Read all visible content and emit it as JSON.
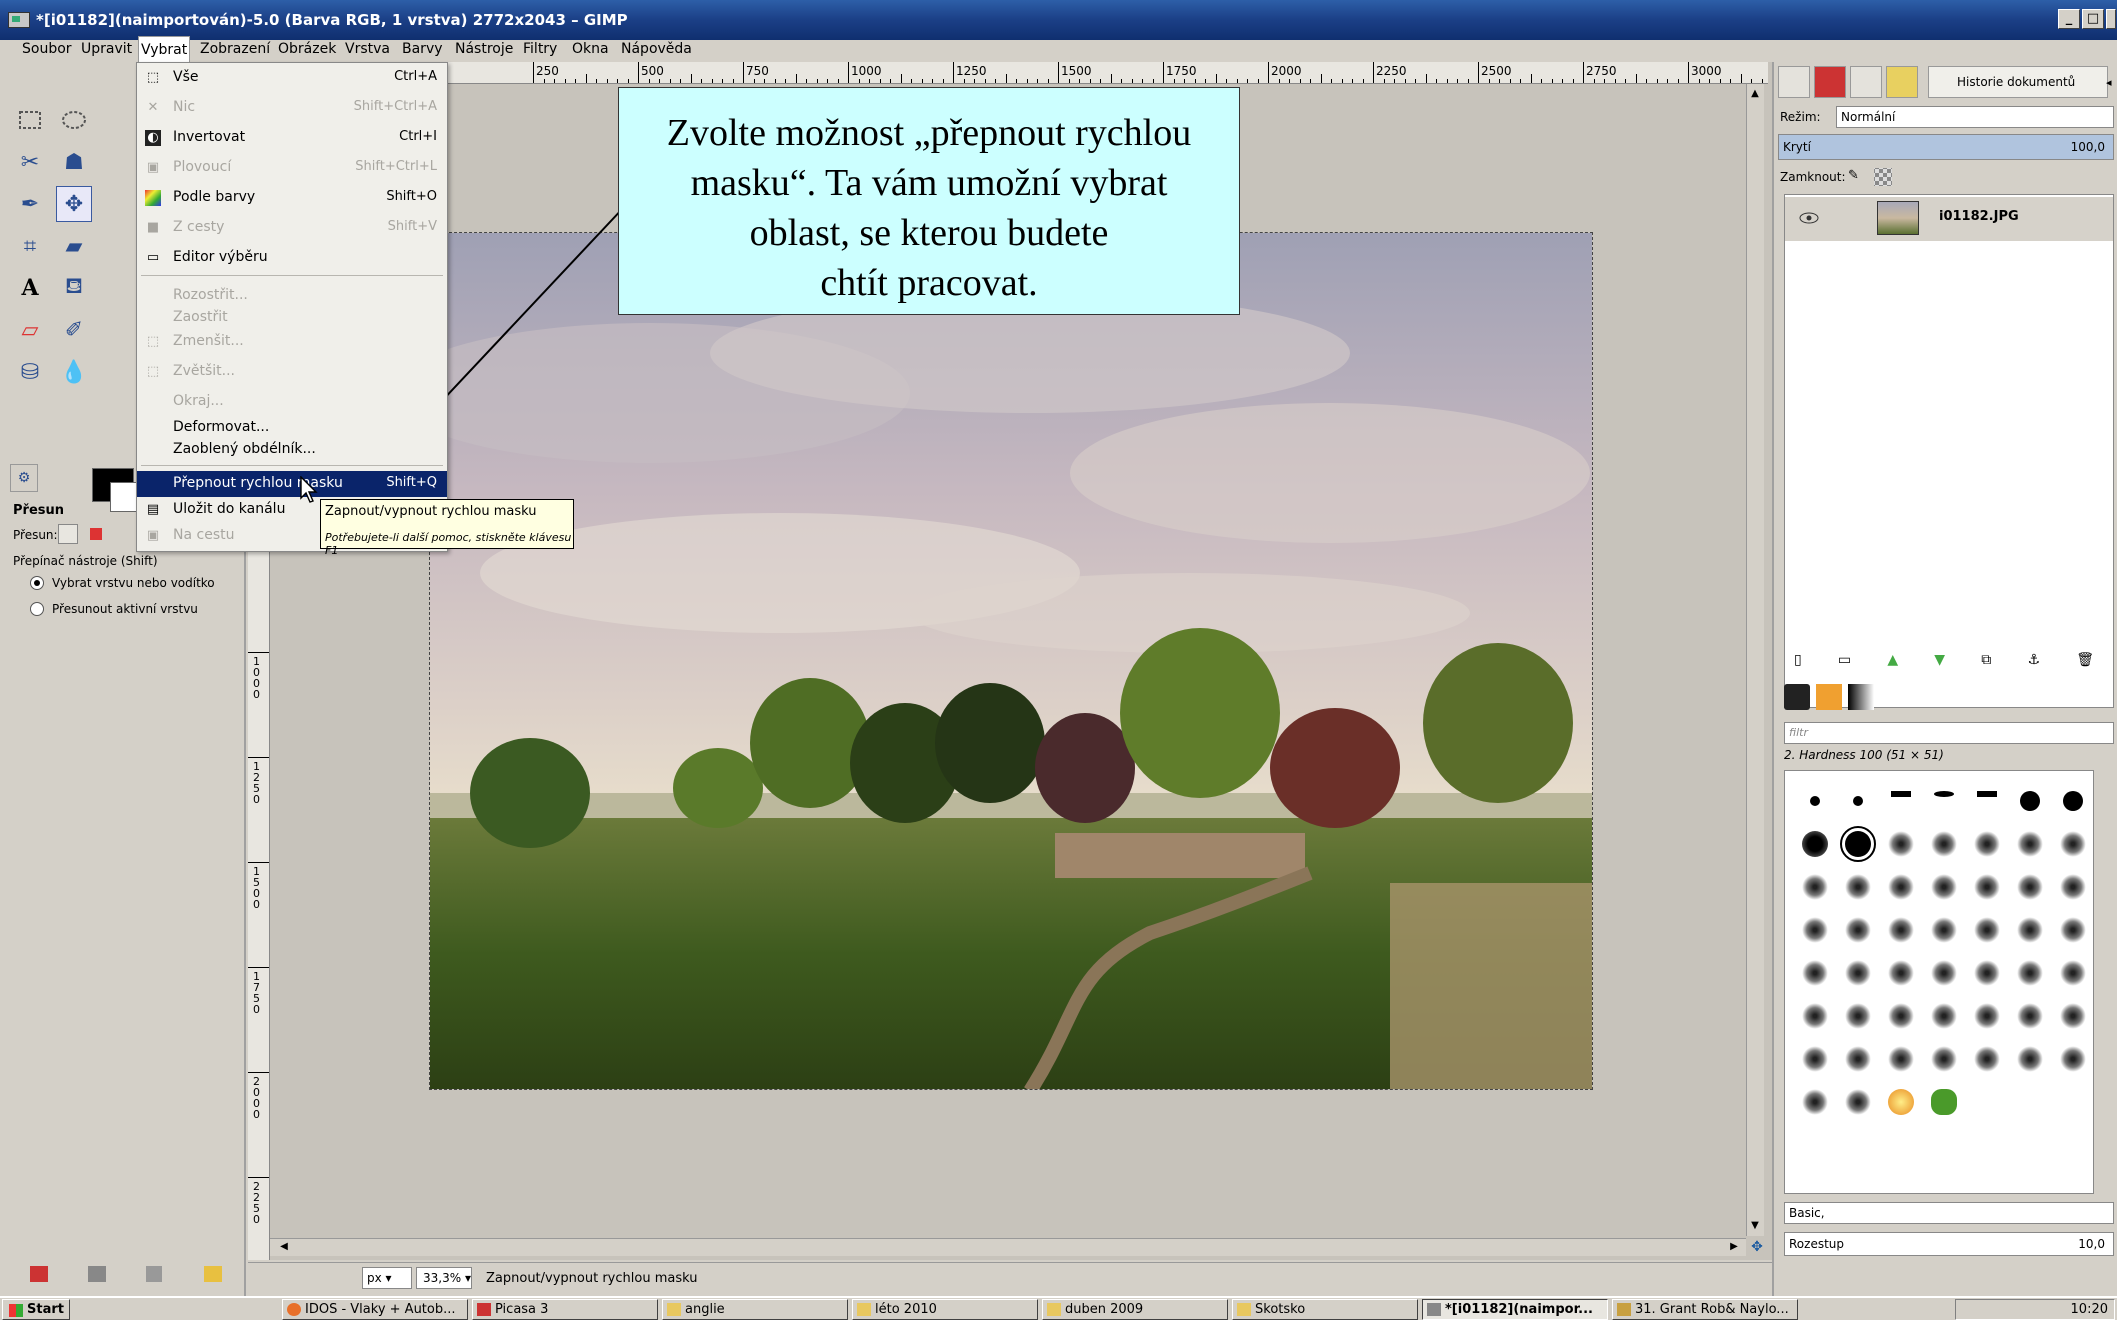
{
  "window": {
    "title": "*[i01182](naimportován)-5.0 (Barva RGB, 1 vrstva) 2772x2043 – GIMP",
    "minimize": "_",
    "maximize": "□",
    "close": "✕"
  },
  "menubar": [
    "Soubor",
    "Upravit",
    "Vybrat",
    "Zobrazení",
    "Obrázek",
    "Vrstva",
    "Barvy",
    "Nástroje",
    "Filtry",
    "Okna",
    "Nápověda"
  ],
  "dropdown": {
    "items": [
      {
        "label": "Vše",
        "shortcut": "Ctrl+A",
        "disabled": false,
        "icon": "select-all-icon"
      },
      {
        "label": "Nic",
        "shortcut": "Shift+Ctrl+A",
        "disabled": true,
        "icon": "select-none-icon"
      },
      {
        "label": "Invertovat",
        "shortcut": "Ctrl+I",
        "disabled": false,
        "icon": "invert-icon"
      },
      {
        "label": "Plovoucí",
        "shortcut": "Shift+Ctrl+L",
        "disabled": true,
        "icon": "float-icon"
      },
      {
        "label": "Podle barvy",
        "shortcut": "Shift+O",
        "disabled": false,
        "icon": "by-color-icon"
      },
      {
        "label": "Z cesty",
        "shortcut": "Shift+V",
        "disabled": true,
        "icon": "from-path-icon"
      },
      {
        "label": "Editor výběru",
        "shortcut": "",
        "disabled": false,
        "icon": "selection-editor-icon"
      },
      {
        "label": "Rozostřit...",
        "shortcut": "",
        "disabled": true,
        "icon": ""
      },
      {
        "label": "Zaostřit",
        "shortcut": "",
        "disabled": true,
        "icon": ""
      },
      {
        "label": "Zmenšit...",
        "shortcut": "",
        "disabled": true,
        "icon": "shrink-icon"
      },
      {
        "label": "Zvětšit...",
        "shortcut": "",
        "disabled": true,
        "icon": "grow-icon"
      },
      {
        "label": "Okraj...",
        "shortcut": "",
        "disabled": true,
        "icon": ""
      },
      {
        "label": "Deformovat...",
        "shortcut": "",
        "disabled": false,
        "icon": ""
      },
      {
        "label": "Zaoblený obdélník...",
        "shortcut": "",
        "disabled": false,
        "icon": ""
      },
      {
        "label": "Přepnout rychlou masku",
        "shortcut": "Shift+Q",
        "disabled": false,
        "icon": "quickmask-icon"
      },
      {
        "label": "Uložit do kanálu",
        "shortcut": "",
        "disabled": false,
        "icon": "save-channel-icon"
      },
      {
        "label": "Na cestu",
        "shortcut": "",
        "disabled": true,
        "icon": "to-path-icon"
      }
    ]
  },
  "tooltip": {
    "title": "Zapnout/vypnout rychlou masku",
    "help": "Potřebujete-li další pomoc, stiskněte klávesu F1"
  },
  "callout": {
    "text": "Zvolte možnost „přepnout rychlou\nmasku“. Ta vám umožní vybrat\noblast, se kterou budete\nchtít pracovat."
  },
  "tool_options": {
    "title": "Přesun",
    "move_label": "Přesun:",
    "switch_label": "Přepínač nástroje (Shift)",
    "radio1": "Vybrat vrstvu nebo vodítko",
    "radio2": "Přesunout aktivní vrstvu"
  },
  "ruler_h": [
    "250",
    "500",
    "750",
    "1000",
    "1250",
    "1500",
    "1750",
    "2000",
    "2250",
    "2500",
    "2750",
    "3000"
  ],
  "ruler_v": [
    "1000",
    "1250",
    "1500",
    "1750",
    "2000",
    "2250"
  ],
  "status": {
    "unit": "px",
    "zoom": "33,3%",
    "message": "Zapnout/vypnout rychlou masku"
  },
  "layers_panel": {
    "history_tab": "Historie dokumentů",
    "mode_label": "Režim:",
    "mode_value": "Normální",
    "opacity_label": "Krytí",
    "opacity_value": "100,0",
    "lock_label": "Zamknout:",
    "layer_name": "i01182.JPG"
  },
  "brushes_panel": {
    "filter_placeholder": "filtr",
    "brush_name": "2. Hardness 100 (51 × 51)",
    "preset": "Basic,",
    "spacing_label": "Rozestup",
    "spacing_value": "10,0"
  },
  "taskbar": {
    "start": "Start",
    "tasks": [
      "IDOS - Vlaky + Autob...",
      "Picasa 3",
      "anglie",
      "léto 2010",
      "duben 2009",
      "Skotsko",
      "*[i01182](naimpor...",
      "31. Grant Rob& Naylo..."
    ],
    "clock": "10:20"
  },
  "colors": {
    "title_bar": "#1b3f86",
    "highlight": "#0a246a",
    "callout_bg": "#ccffff",
    "tooltip_bg": "#ffffe1"
  }
}
